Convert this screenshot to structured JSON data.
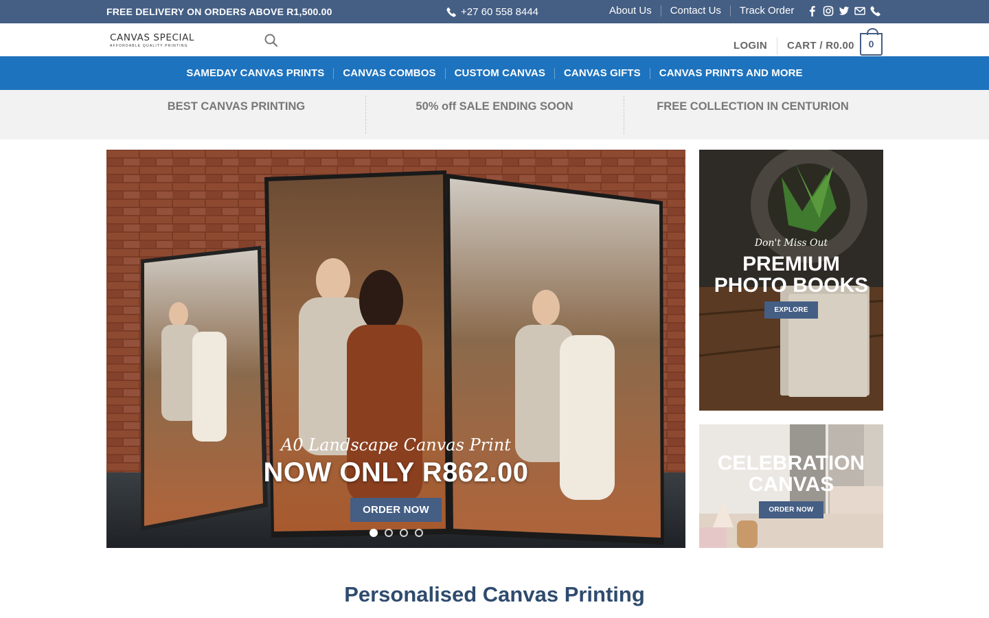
{
  "topbar": {
    "promo": "FREE DELIVERY ON ORDERS ABOVE R1,500.00",
    "phone": "+27 60 558 8444",
    "links": [
      "About Us",
      "Contact Us",
      "Track Order"
    ],
    "social_icons": [
      "facebook-icon",
      "instagram-icon",
      "twitter-icon",
      "email-icon",
      "phone-icon"
    ]
  },
  "header": {
    "logo_title": "CANVAS SPECIAL",
    "logo_tagline": "AFFORDABLE QUALITY PRINTING",
    "login": "LOGIN",
    "cart_label": "CART / R0.00",
    "cart_count": "0"
  },
  "nav": {
    "items": [
      "SAMEDAY CANVAS PRINTS",
      "CANVAS COMBOS",
      "CUSTOM CANVAS",
      "CANVAS GIFTS",
      "CANVAS PRINTS AND MORE"
    ]
  },
  "features": [
    "BEST CANVAS PRINTING",
    "50% off SALE ENDING SOON",
    "FREE COLLECTION IN CENTURION"
  ],
  "hero": {
    "subtitle": "A0 Landscape Canvas Print",
    "title": "NOW ONLY R862.00",
    "button": "ORDER NOW",
    "slide_count": 4,
    "active_slide": 1
  },
  "promo1": {
    "script": "Don't Miss Out",
    "title_line1": "PREMIUM",
    "title_line2": "PHOTO BOOKS",
    "button": "EXPLORE"
  },
  "promo2": {
    "title_line1": "CELEBRATION",
    "title_line2": "CANVAS",
    "button": "ORDER NOW"
  },
  "section": {
    "title": "Personalised Canvas Printing"
  },
  "colors": {
    "topbar": "#445e84",
    "nav": "#1e73be",
    "feature_bg": "#f2f2f2",
    "title": "#2f4b6e"
  }
}
